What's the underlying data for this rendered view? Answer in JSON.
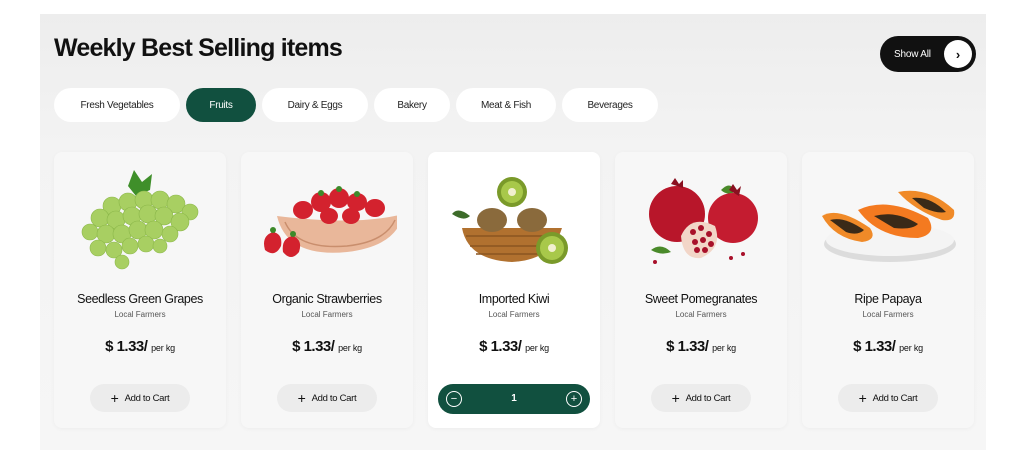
{
  "header": {
    "title": "Weekly Best Selling items",
    "show_all_label": "Show All",
    "show_all_icon": "chevron-right-icon"
  },
  "tabs": [
    {
      "label": "Fresh Vegetables",
      "active": false
    },
    {
      "label": "Fruits",
      "active": true
    },
    {
      "label": "Dairy & Eggs",
      "active": false
    },
    {
      "label": "Bakery",
      "active": false
    },
    {
      "label": "Meat & Fish",
      "active": false
    },
    {
      "label": "Beverages",
      "active": false
    }
  ],
  "products": [
    {
      "name": "Seedless Green Grapes",
      "source": "Local Farmers",
      "price": "$ 1.33/",
      "unit": "per kg",
      "image": "green-grapes",
      "action": "Add to Cart"
    },
    {
      "name": "Organic Strawberries",
      "source": "Local Farmers",
      "price": "$ 1.33/",
      "unit": "per kg",
      "image": "strawberries-bowl",
      "action": "Add to Cart"
    },
    {
      "name": "Imported Kiwi",
      "source": "Local Farmers",
      "price": "$ 1.33/",
      "unit": "per kg",
      "image": "kiwi-basket",
      "quantity": "1"
    },
    {
      "name": "Sweet Pomegranates",
      "source": "Local Farmers",
      "price": "$ 1.33/",
      "unit": "per kg",
      "image": "pomegranates",
      "action": "Add to Cart"
    },
    {
      "name": "Ripe Papaya",
      "source": "Local Farmers",
      "price": "$ 1.33/",
      "unit": "per kg",
      "image": "papaya-plate",
      "action": "Add to Cart"
    }
  ],
  "colors": {
    "accent": "#11503f",
    "dark": "#111111",
    "card": "#f7f7f7"
  }
}
